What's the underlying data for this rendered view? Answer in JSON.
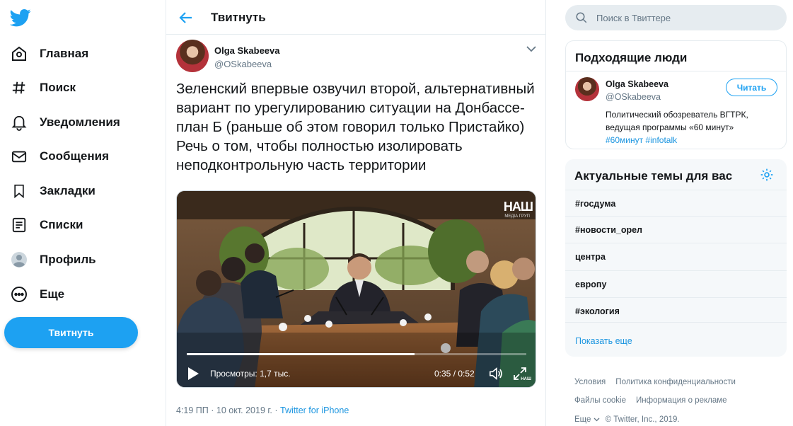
{
  "nav": {
    "items": [
      {
        "label": "Главная",
        "icon": "home-icon"
      },
      {
        "label": "Поиск",
        "icon": "hashtag-icon"
      },
      {
        "label": "Уведомления",
        "icon": "bell-icon"
      },
      {
        "label": "Сообщения",
        "icon": "mail-icon"
      },
      {
        "label": "Закладки",
        "icon": "bookmark-icon"
      },
      {
        "label": "Списки",
        "icon": "list-icon"
      },
      {
        "label": "Профиль",
        "icon": "profile-icon"
      },
      {
        "label": "Еще",
        "icon": "more-icon"
      }
    ],
    "tweet_button": "Твитнуть"
  },
  "header": {
    "title": "Твитнуть"
  },
  "tweet": {
    "author_name": "Olga Skabeeva",
    "author_handle": "@OSkabeeva",
    "text": "Зеленский впервые озвучил второй, альтернативный вариант по урегулированию ситуации на Донбассе- план Б (раньше об этом говорил только Пристайко) Речь о том, чтобы полностью изолировать неподконтрольную часть территории",
    "video": {
      "channel_logo": "НАШ",
      "channel_sub": "МЕДІА ГРУП",
      "watermark": "НАШ",
      "views": "Просмотры: 1,7 тыс.",
      "time": "0:35 / 0:52",
      "progress": 0.67
    },
    "meta_date": "4:19 ПП · 10 окт. 2019 г. · ",
    "meta_source": "Twitter for iPhone"
  },
  "search": {
    "placeholder": "Поиск в Твиттере"
  },
  "who_to_follow": {
    "title": "Подходящие люди",
    "name": "Olga Skabeeva",
    "handle": "@OSkabeeva",
    "follow_label": "Читать",
    "bio": "Политический обозреватель ВГТРК, ведущая программы «60 минут»",
    "tag1": "#60минут",
    "tag2": "#infotalk"
  },
  "trends": {
    "title": "Актуальные темы для вас",
    "items": [
      "#госдума",
      "#новости_орел",
      "центра",
      "европу",
      "#экология"
    ],
    "show_more": "Показать еще"
  },
  "footer": {
    "terms": "Условия",
    "privacy": "Политика конфиденциальности",
    "cookies": "Файлы cookie",
    "ads": "Информация о рекламе",
    "more": "Еще",
    "copyright": "© Twitter, Inc., 2019."
  },
  "colors": {
    "accent": "#1da1f2",
    "link": "#1b95e0",
    "muted": "#657786"
  }
}
